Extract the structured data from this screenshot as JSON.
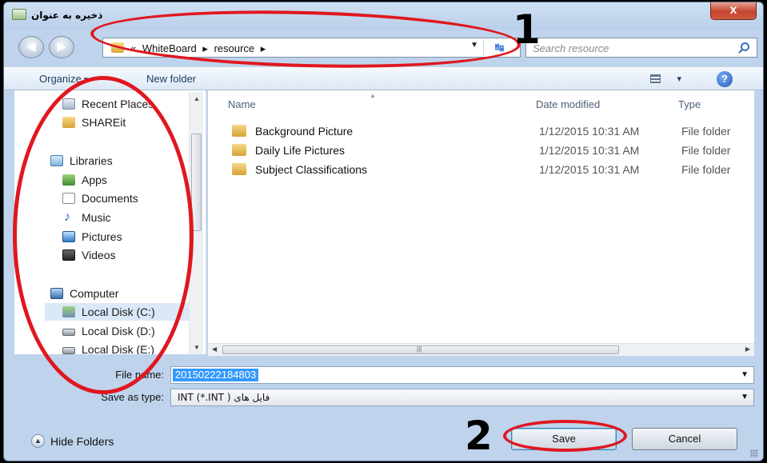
{
  "window": {
    "title": "ذخیره به عنوان",
    "close_label": "x"
  },
  "navigation": {
    "back_label": "◀",
    "forward_label": "▶"
  },
  "address_bar": {
    "breadcrumbs": [
      "«",
      "WhiteBoard",
      "▸",
      "resource",
      "▸"
    ],
    "dropdown_label": "▼",
    "refresh_label": "↹"
  },
  "search": {
    "placeholder": "Search resource"
  },
  "toolbar": {
    "organize_label": "Organize",
    "new_folder_label": "New folder",
    "views_dropdown_label": "▾",
    "help_label": "?"
  },
  "nav_pane": {
    "items": [
      {
        "label": "Recent Places",
        "icon": "recent-places-icon"
      },
      {
        "label": "SHAREit",
        "icon": "folder-icon"
      },
      {
        "label": "Libraries",
        "icon": "libraries-icon"
      },
      {
        "label": "Apps",
        "icon": "apps-icon"
      },
      {
        "label": "Documents",
        "icon": "documents-icon"
      },
      {
        "label": "Music",
        "icon": "music-icon"
      },
      {
        "label": "Pictures",
        "icon": "pictures-icon"
      },
      {
        "label": "Videos",
        "icon": "videos-icon"
      },
      {
        "label": "Computer",
        "icon": "computer-icon"
      },
      {
        "label": "Local Disk (C:)",
        "icon": "local-disk-c-icon",
        "selected": true
      },
      {
        "label": "Local Disk (D:)",
        "icon": "local-disk-icon"
      },
      {
        "label": "Local Disk (E:)",
        "icon": "local-disk-icon"
      }
    ]
  },
  "file_list": {
    "columns": [
      "Name",
      "Date modified",
      "Type"
    ],
    "rows": [
      {
        "name": "Background Picture",
        "date": "1/12/2015 10:31 AM",
        "type": "File folder"
      },
      {
        "name": "Daily Life Pictures",
        "date": "1/12/2015 10:31 AM",
        "type": "File folder"
      },
      {
        "name": "Subject Classifications",
        "date": "1/12/2015 10:31 AM",
        "type": "File folder"
      }
    ]
  },
  "save_form": {
    "file_name_label": "File name:",
    "file_name_value": "20150222184803",
    "save_as_type_label": "Save as type:",
    "save_as_type_value": "فایل های INT (*.INT )"
  },
  "footer": {
    "hide_folders_label": "Hide Folders",
    "save_label": "Save",
    "cancel_label": "Cancel"
  },
  "annotations": {
    "marker_1": "1",
    "marker_2": "2",
    "color": "#e0171f"
  }
}
